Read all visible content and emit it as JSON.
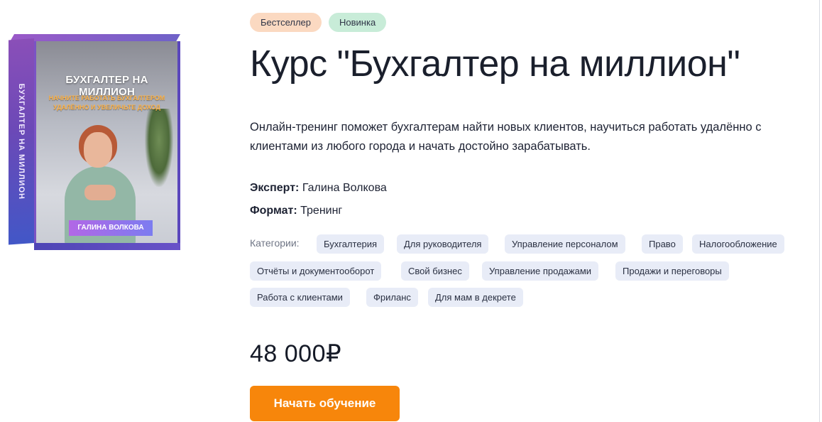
{
  "product_cover": {
    "spine_text": "БУХГАЛТЕР НА МИЛЛИОН",
    "title": "БУХГАЛТЕР НА МИЛЛИОН",
    "subtitle_line1": "НАЧНИТЕ РАБОТАТЬ БУХГАЛТЕРОМ",
    "subtitle_line2": "УДАЛЁННО И УВЕЛИЧЬТЕ ДОХОД",
    "author_label": "ГАЛИНА ВОЛКОВА"
  },
  "badges": {
    "bestseller": "Бестселлер",
    "new": "Новинка"
  },
  "title": "Курс \"Бухгалтер на миллион\"",
  "description": {
    "line1": "Онлайн-тренинг поможет бухгалтерам найти новых клиентов, научиться работать удалённо с",
    "line2": "клиентами из любого города и начать достойно зарабатывать."
  },
  "expert": {
    "label": "Эксперт:",
    "value": "Галина Волкова"
  },
  "format": {
    "label": "Формат:",
    "value": "Тренинг"
  },
  "categories": {
    "label": "Категории:",
    "items": [
      "Бухгалтерия",
      "Для руководителя",
      "Управление персоналом",
      "Право",
      "Налогообложение",
      "Отчёты и документооборот",
      "Свой бизнес",
      "Управление продажами",
      "Продажи и переговоры",
      "Работа с клиентами",
      "Фриланс",
      "Для мам в декрете"
    ]
  },
  "price": "48 000₽",
  "cta_label": "Начать обучение",
  "colors": {
    "accent": "#f7860b",
    "tag_bg": "#e8ecf7",
    "badge_bestseller_bg": "#fbd9c1",
    "badge_new_bg": "#c8ecd8"
  }
}
